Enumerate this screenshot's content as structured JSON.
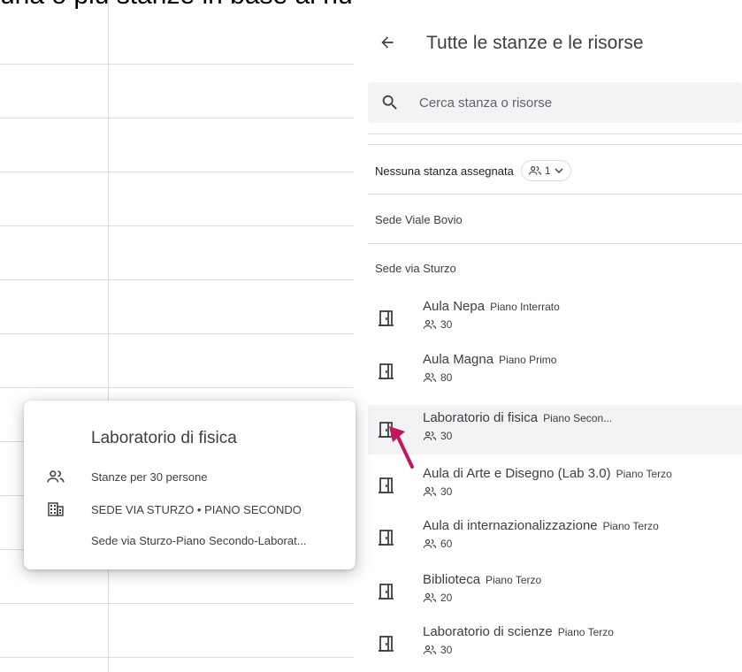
{
  "top_caption": "una o piu stanze in base al numero di partecipanti",
  "panel": {
    "title": "Tutte le stanze e le risorse",
    "search_placeholder": "Cerca stanza o risorse",
    "unassigned_label": "Nessuna stanza assegnata",
    "capacity_filter": "1",
    "sections": [
      "Sede Viale Bovio",
      "Sede via Sturzo"
    ],
    "rooms": [
      {
        "name": "Aula Nepa",
        "floor": "Piano Interrato",
        "capacity": "30"
      },
      {
        "name": "Aula Magna",
        "floor": "Piano Primo",
        "capacity": "80"
      },
      {
        "name": "Laboratorio di fisica",
        "floor": "Piano Secon...",
        "capacity": "30"
      },
      {
        "name": "Aula di Arte e Disegno (Lab 3.0)",
        "floor": "Piano Terzo",
        "capacity": "30"
      },
      {
        "name": "Aula di internazionalizzazione",
        "floor": "Piano Terzo",
        "capacity": "60"
      },
      {
        "name": "Biblioteca",
        "floor": "Piano Terzo",
        "capacity": "20"
      },
      {
        "name": "Laboratorio di scienze",
        "floor": "Piano Terzo",
        "capacity": "30"
      }
    ]
  },
  "popover": {
    "title": "Laboratorio di fisica",
    "capacity_text": "Stanze per 30 persone",
    "location_text": "SEDE VIA STURZO • PIANO SECONDO",
    "path_text": "Sede via Sturzo-Piano Secondo-Laborat..."
  },
  "colors": {
    "accent_arrow": "#c2185b",
    "highlight_row": "#f1f3f4",
    "search_bg": "#f1f3f4"
  }
}
